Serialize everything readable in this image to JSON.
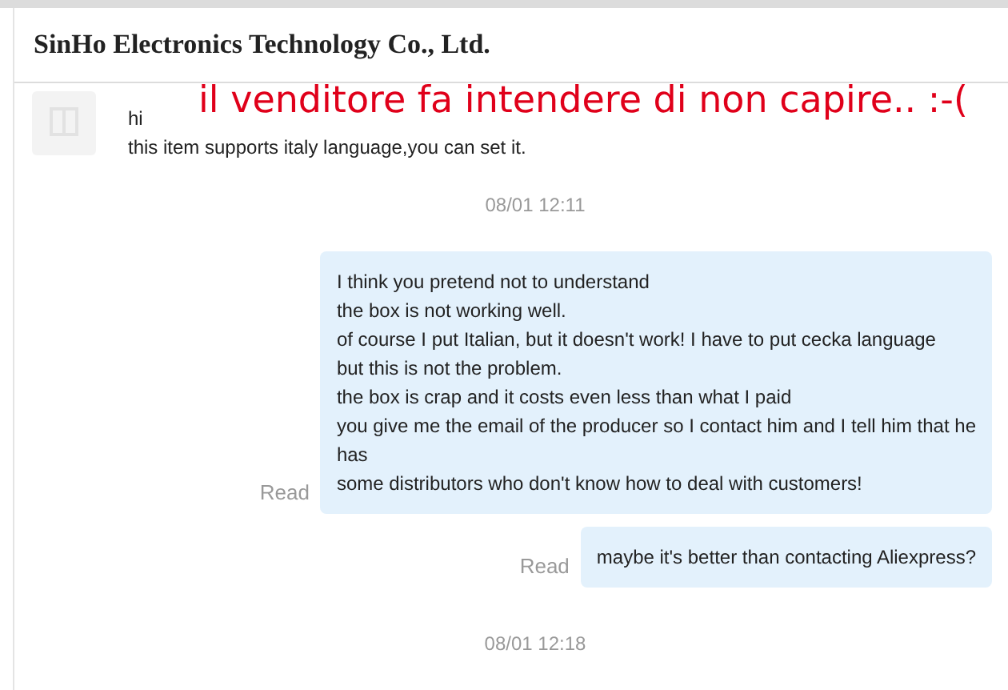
{
  "header": {
    "title": "SinHo Electronics Technology Co., Ltd."
  },
  "annotation": "il venditore fa intendere di non capire.. :-(",
  "messages": [
    {
      "kind": "incoming",
      "lines": [
        "hi",
        "this item supports italy language,you can set it."
      ]
    },
    {
      "kind": "time",
      "text": "08/01 12:11"
    },
    {
      "kind": "outgoing",
      "status": "Read",
      "lines": [
        "I think you pretend not to understand",
        "the box is not working well.",
        "of course I put Italian, but it doesn't work! I have to put cecka language",
        "but this is not the problem.",
        "the box is crap and it costs even less than what I paid",
        "you give me the email of the producer so I contact him and I tell him that he",
        "has",
        "some distributors who don't know how to deal with customers!"
      ]
    },
    {
      "kind": "outgoing",
      "status": "Read",
      "lines": [
        "maybe it's better than contacting Aliexpress?"
      ]
    },
    {
      "kind": "time",
      "text": "08/01 12:18"
    }
  ]
}
